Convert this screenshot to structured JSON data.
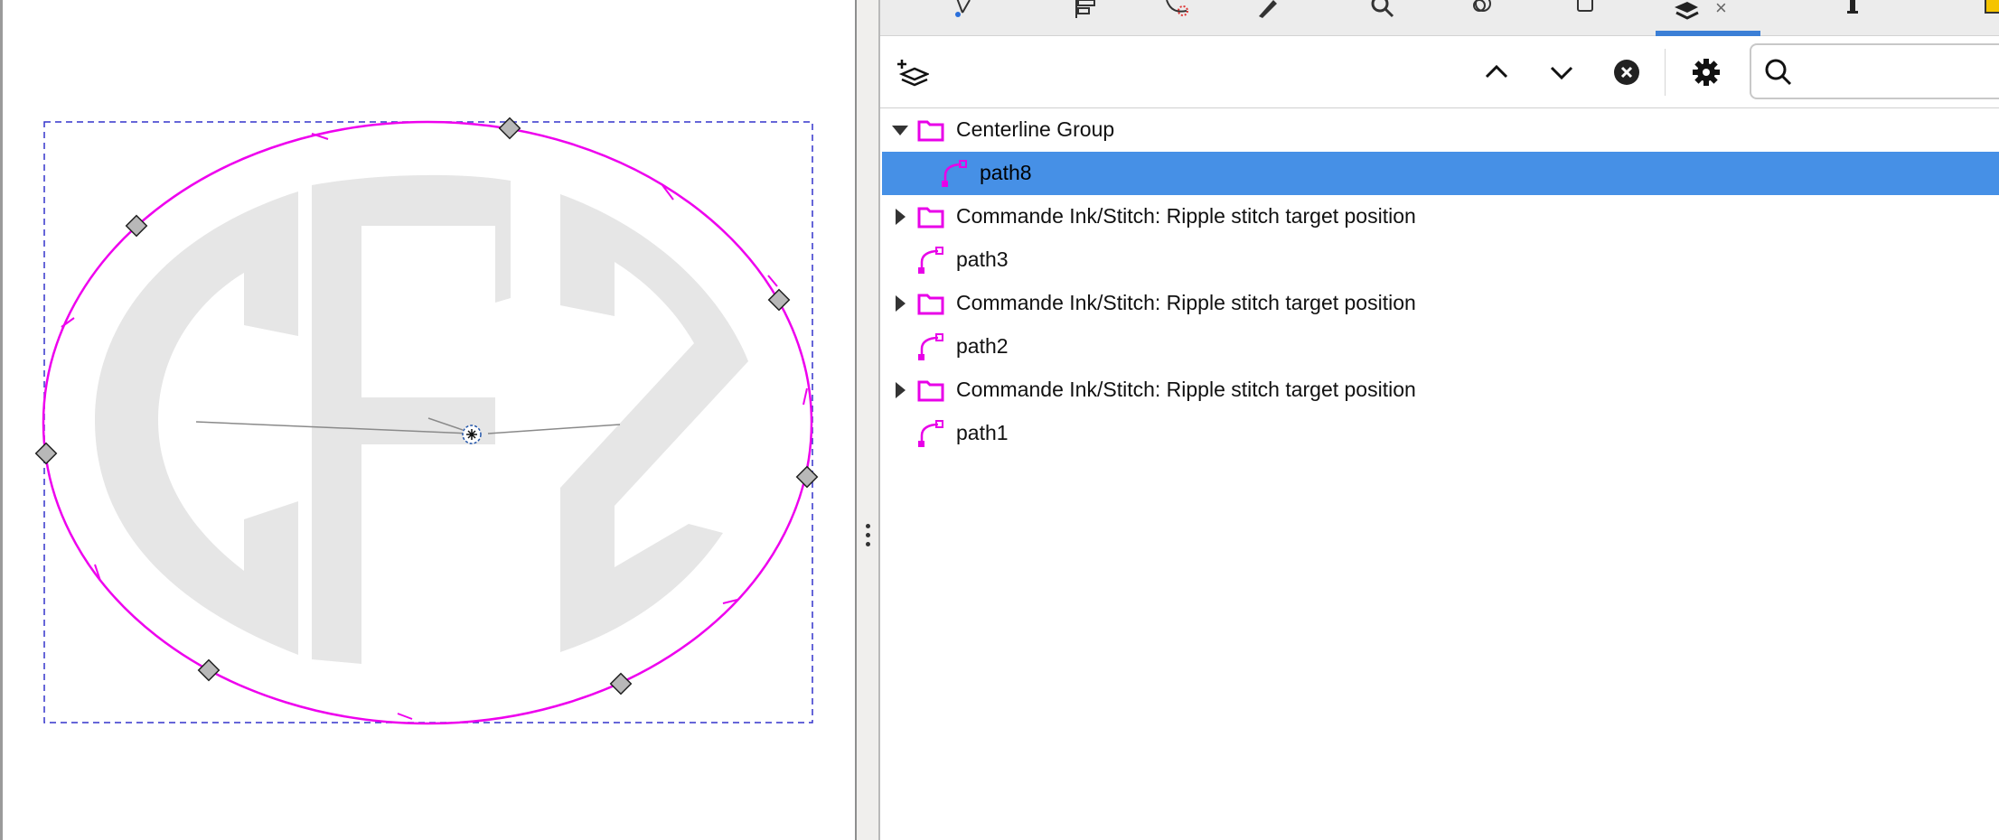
{
  "dock": {
    "tabs": [
      {
        "icon": "node-editor-icon"
      },
      {
        "icon": "align-distribute-icon"
      },
      {
        "icon": "path-effects-icon"
      },
      {
        "icon": "fill-stroke-icon"
      },
      {
        "icon": "find-replace-icon"
      },
      {
        "icon": "symbols-icon"
      },
      {
        "icon": "document-properties-icon"
      },
      {
        "icon": "layers-objects-icon",
        "active": true
      },
      {
        "icon": "text-font-icon"
      },
      {
        "icon": "export-icon"
      }
    ],
    "active_tab_close": "×"
  },
  "toolbar": {
    "add_layer_icon": "add-layer-icon",
    "move_up_icon": "chevron-up-icon",
    "move_down_icon": "chevron-down-icon",
    "remove_icon": "remove-circle-icon",
    "settings_icon": "gear-icon",
    "search_placeholder": "",
    "search_value": ""
  },
  "tree": [
    {
      "label": "Centerline Group",
      "type": "group",
      "expanded": true,
      "depth": 0
    },
    {
      "label": "path8",
      "type": "path",
      "depth": 1,
      "selected": true
    },
    {
      "label": "Commande Ink/Stitch: Ripple stitch target position",
      "type": "group",
      "expanded": false,
      "depth": 0
    },
    {
      "label": "path3",
      "type": "path",
      "depth": 0
    },
    {
      "label": "Commande Ink/Stitch: Ripple stitch target position",
      "type": "group",
      "expanded": false,
      "depth": 0
    },
    {
      "label": "path2",
      "type": "path",
      "depth": 0
    },
    {
      "label": "Commande Ink/Stitch: Ripple stitch target position",
      "type": "group",
      "expanded": false,
      "depth": 0
    },
    {
      "label": "path1",
      "type": "path",
      "depth": 0
    }
  ],
  "colors": {
    "accent": "#4690e6",
    "tab_indicator": "#3b7fd6",
    "path_stroke": "#ee00ee",
    "bbox": "#3333cc",
    "logo_fill": "#e6e6e6",
    "icon_magenta": "#e800e8"
  }
}
